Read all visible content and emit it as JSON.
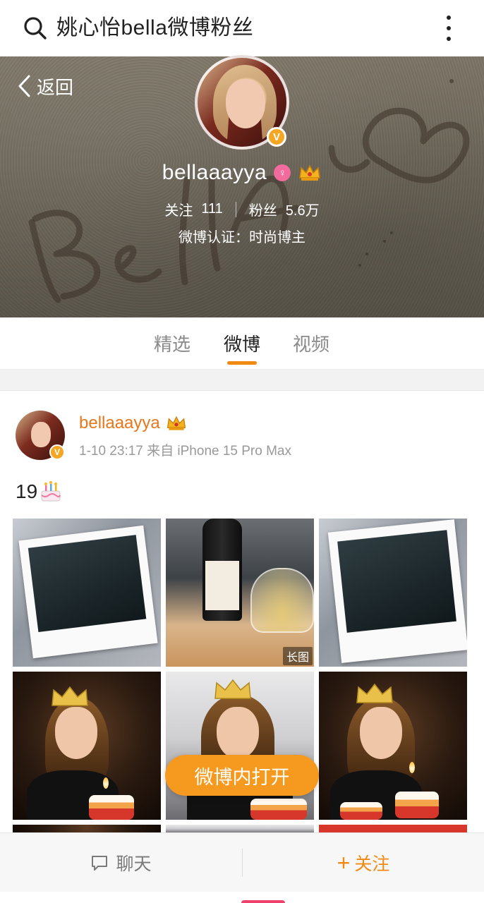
{
  "search": {
    "query": "姚心怡bella微博粉丝"
  },
  "profile": {
    "back_label": "返回",
    "name": "bellaaayya",
    "following_label": "关注",
    "following_count": "111",
    "followers_label": "粉丝",
    "followers_count": "5.6万",
    "verification": "微博认证：时尚博主",
    "verified_mark": "V"
  },
  "tabs": [
    {
      "label": "精选"
    },
    {
      "label": "微博"
    },
    {
      "label": "视频"
    }
  ],
  "post": {
    "author": "bellaaayya",
    "meta": "1-10 23:17 来自 iPhone 15 Pro Max",
    "text": "19",
    "verified_mark": "V",
    "long_image_tag": "长图",
    "open_in_app": "微博内打开"
  },
  "bottom_bar": {
    "chat_label": "聊天",
    "follow_label": "关注"
  },
  "colors": {
    "accent": "#f08a12",
    "verify": "#f5a623",
    "name_orange": "#e8761b"
  }
}
